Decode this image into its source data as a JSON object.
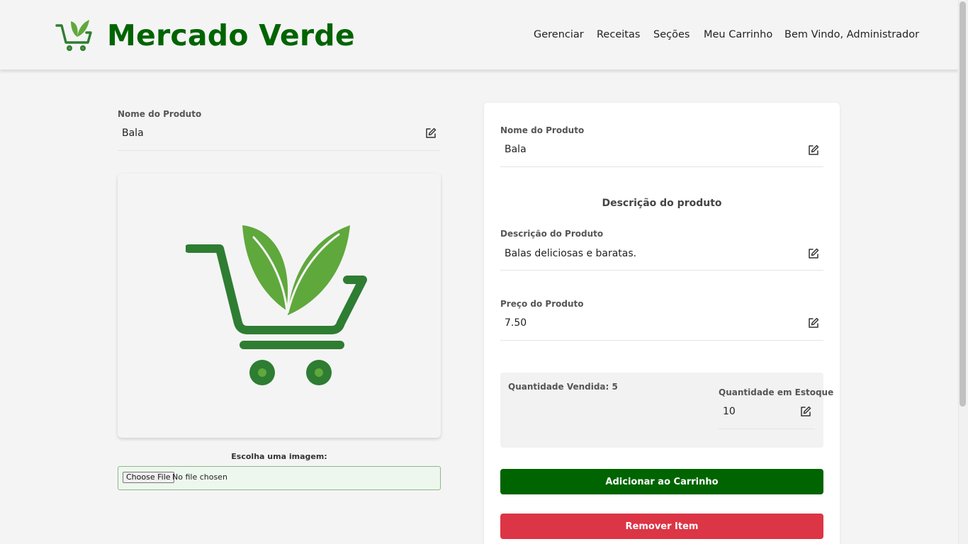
{
  "header": {
    "brand": "Mercado Verde",
    "nav": [
      "Gerenciar",
      "Receitas",
      "Seções",
      "Meu Carrinho",
      "Bem Vindo, Administrador"
    ]
  },
  "left": {
    "name_label": "Nome do Produto",
    "name_value": "Bala",
    "file_label": "Escolha uma imagem:",
    "file_button": "Choose File",
    "file_status": "No file chosen"
  },
  "right": {
    "name_label": "Nome do Produto",
    "name_value": "Bala",
    "section_title": "Descrição do produto",
    "desc_label": "Descrição do Produto",
    "desc_value": "Balas deliciosas e baratas.",
    "price_label": "Preço do Produto",
    "price_value": "7.50",
    "sold": "Quantidade Vendida: 5",
    "stock_label": "Quantidade em Estoque",
    "stock_value": "10",
    "add_button": "Adicionar ao Carrinho",
    "remove_button": "Remover Item"
  },
  "colors": {
    "brand_green": "#006400",
    "leaf_light": "#5fa83c",
    "cart_dark": "#2e7d32",
    "danger": "#dc3545"
  },
  "icons": [
    "cart-leaf-logo-icon",
    "edit-icon"
  ]
}
